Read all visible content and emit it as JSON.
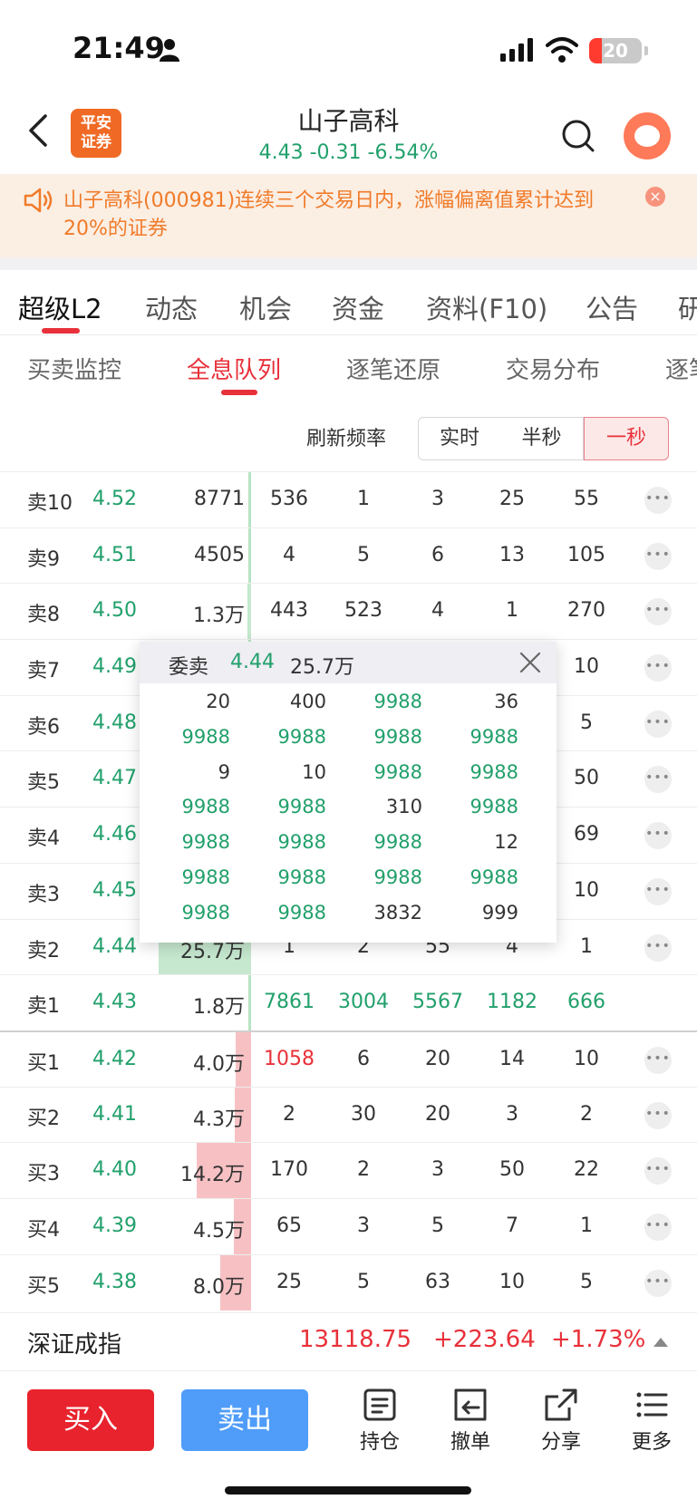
{
  "status_bar": {
    "time": "21:49",
    "battery": "20"
  },
  "header": {
    "broker_logo_line1": "平安",
    "broker_logo_line2": "证券",
    "stock_name": "山子高科",
    "quote": "4.43 -0.31 -6.54%"
  },
  "notice": {
    "text": "山子高科(000981)连续三个交易日内，涨幅偏离值累计达到20%的证券",
    "close_label": "×"
  },
  "main_tabs": [
    {
      "label": "超级L2",
      "active": true
    },
    {
      "label": "动态"
    },
    {
      "label": "机会"
    },
    {
      "label": "资金"
    },
    {
      "label": "资料(F10)"
    },
    {
      "label": "公告"
    },
    {
      "label": "研"
    }
  ],
  "sub_tabs": [
    {
      "label": "买卖监控"
    },
    {
      "label": "全息队列",
      "active": true
    },
    {
      "label": "逐笔还原"
    },
    {
      "label": "交易分布"
    },
    {
      "label": "逐笔"
    }
  ],
  "refresh": {
    "label": "刷新频率",
    "options": [
      "实时",
      "半秒",
      "一秒"
    ],
    "selected": "一秒"
  },
  "order_book": [
    {
      "label": "卖10",
      "price": "4.52",
      "vol": "8771",
      "q": [
        "536",
        "1",
        "3",
        "25",
        "55"
      ],
      "side": "sell",
      "bar_level": 0.0
    },
    {
      "label": "卖9",
      "price": "4.51",
      "vol": "4505",
      "q": [
        "4",
        "5",
        "6",
        "13",
        "105"
      ],
      "side": "sell",
      "bar_level": 0.0
    },
    {
      "label": "卖8",
      "price": "4.50",
      "vol": "1.3万",
      "q": [
        "443",
        "523",
        "4",
        "1",
        "270"
      ],
      "side": "sell",
      "bar_level": 0.03
    },
    {
      "label": "卖7",
      "price": "4.49",
      "vol": "",
      "q": [
        "",
        "",
        "",
        "",
        "10"
      ],
      "side": "sell",
      "bar_level": 0.0
    },
    {
      "label": "卖6",
      "price": "4.48",
      "vol": "",
      "q": [
        "",
        "",
        "",
        "",
        "5"
      ],
      "side": "sell",
      "bar_level": 0.0
    },
    {
      "label": "卖5",
      "price": "4.47",
      "vol": "",
      "q": [
        "",
        "",
        "",
        "",
        "50"
      ],
      "side": "sell",
      "bar_level": 0.0
    },
    {
      "label": "卖4",
      "price": "4.46",
      "vol": "",
      "q": [
        "",
        "",
        "",
        "",
        "69"
      ],
      "side": "sell",
      "bar_level": 0.0
    },
    {
      "label": "卖3",
      "price": "4.45",
      "vol": "",
      "q": [
        "",
        "",
        "",
        "",
        "10"
      ],
      "side": "sell",
      "bar_level": 0.0
    },
    {
      "label": "卖2",
      "price": "4.44",
      "vol": "25.7万",
      "q": [
        "1",
        "2",
        "55",
        "4",
        "1"
      ],
      "side": "sell",
      "bar_level": 0.85
    },
    {
      "label": "卖1",
      "price": "4.43",
      "vol": "1.8万",
      "q": [
        "7861",
        "3004",
        "5567",
        "1182",
        "666"
      ],
      "side": "sell",
      "bar_level": 0.0,
      "highlight_q": "green",
      "no_more": true
    },
    {
      "label": "买1",
      "price": "4.42",
      "vol": "4.0万",
      "q": [
        "1058",
        "6",
        "20",
        "14",
        "10"
      ],
      "side": "buy",
      "bar_level": 0.14,
      "first_q_red": true
    },
    {
      "label": "买2",
      "price": "4.41",
      "vol": "4.3万",
      "q": [
        "2",
        "30",
        "20",
        "3",
        "2"
      ],
      "side": "buy",
      "bar_level": 0.15
    },
    {
      "label": "买3",
      "price": "4.40",
      "vol": "14.2万",
      "q": [
        "170",
        "2",
        "3",
        "50",
        "22"
      ],
      "side": "buy",
      "bar_level": 0.5
    },
    {
      "label": "买4",
      "price": "4.39",
      "vol": "4.5万",
      "q": [
        "65",
        "3",
        "5",
        "7",
        "1"
      ],
      "side": "buy",
      "bar_level": 0.16
    },
    {
      "label": "买5",
      "price": "4.38",
      "vol": "8.0万",
      "q": [
        "25",
        "5",
        "63",
        "10",
        "5"
      ],
      "side": "buy",
      "bar_level": 0.28
    }
  ],
  "popup": {
    "title": "委卖",
    "price": "4.44",
    "volume": "25.7万",
    "cells": [
      [
        "20",
        "400",
        "9988",
        "36"
      ],
      [
        "9988",
        "9988",
        "9988",
        "9988"
      ],
      [
        "9",
        "10",
        "9988",
        "9988"
      ],
      [
        "9988",
        "9988",
        "310",
        "9988"
      ],
      [
        "9988",
        "9988",
        "9988",
        "12"
      ],
      [
        "9988",
        "9988",
        "9988",
        "9988"
      ],
      [
        "9988",
        "9988",
        "3832",
        "999"
      ]
    ],
    "big_order_value": "9988",
    "colors": {
      "big": "#22a06b",
      "normal": "#333333"
    }
  },
  "index_bar": {
    "name": "深证成指",
    "value": "13118.75",
    "change": "+223.64",
    "pct": "+1.73%"
  },
  "bottom": {
    "buy_label": "买入",
    "sell_label": "卖出",
    "tools": [
      {
        "label": "持仓",
        "icon": "document-icon"
      },
      {
        "label": "撤单",
        "icon": "undo-icon"
      },
      {
        "label": "分享",
        "icon": "share-icon"
      },
      {
        "label": "更多",
        "icon": "menu-icon"
      }
    ]
  },
  "colors": {
    "up": "#e8313a",
    "down": "#22a06b",
    "accent": "#f06a25"
  }
}
